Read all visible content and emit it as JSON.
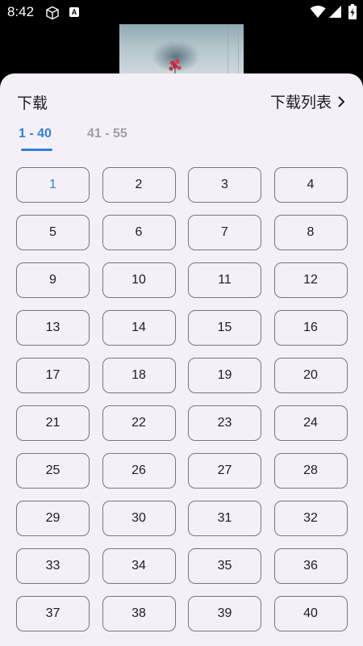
{
  "status_bar": {
    "time": "8:42",
    "icons": [
      "cube-icon",
      "a-badge-icon",
      "wifi-icon",
      "signal-icon",
      "battery-icon"
    ],
    "a_badge_text": "A"
  },
  "sheet": {
    "title": "下载",
    "download_list_label": "下载列表",
    "tabs": [
      {
        "label": "1 - 40",
        "active": true
      },
      {
        "label": "41 - 55",
        "active": false
      }
    ],
    "selected_episode": "1",
    "episodes": [
      "1",
      "2",
      "3",
      "4",
      "5",
      "6",
      "7",
      "8",
      "9",
      "10",
      "11",
      "12",
      "13",
      "14",
      "15",
      "16",
      "17",
      "18",
      "19",
      "20",
      "21",
      "22",
      "23",
      "24",
      "25",
      "26",
      "27",
      "28",
      "29",
      "30",
      "31",
      "32",
      "33",
      "34",
      "35",
      "36",
      "37",
      "38",
      "39",
      "40"
    ]
  },
  "colors": {
    "accent": "#2f7fd6",
    "sheet_bg": "#f5f0f7",
    "outline": "#79747e",
    "inactive_tab": "#9e9e9e"
  }
}
